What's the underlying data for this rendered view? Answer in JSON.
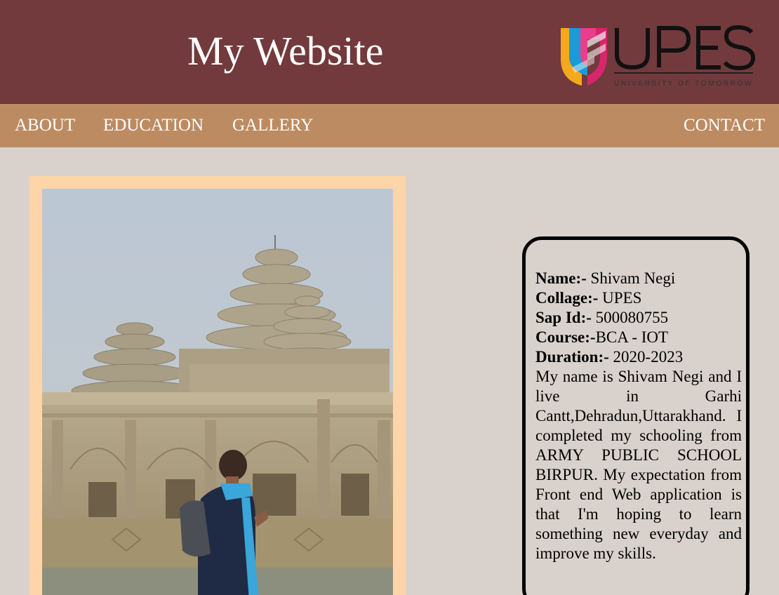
{
  "header": {
    "title": "My Website",
    "logo": {
      "wordmark": "UPES",
      "tagline": "UNIVERSITY OF TOMORROW"
    }
  },
  "nav": {
    "about": "ABOUT",
    "education": "EDUCATION",
    "gallery": "GALLERY",
    "contact": "CONTACT"
  },
  "photo": {
    "icon": "temple-photo"
  },
  "profile": {
    "name_label": "Name:-",
    "name_value": " Shivam Negi",
    "college_label": "Collage:-",
    "college_value": " UPES",
    "sap_label": "Sap Id:-",
    "sap_value": " 500080755",
    "course_label": "Course:-",
    "course_value": "BCA - IOT",
    "duration_label": "Duration:-",
    "duration_value": " 2020-2023",
    "bio": "My name is Shivam Negi and I live in Garhi Cantt,Dehradun,Uttarakhand. I completed my schooling from ARMY PUBLIC SCHOOL BIRPUR. My expectation from Front end Web application is that I'm hoping to learn something new everyday and improve my skills."
  },
  "colors": {
    "header_bg": "#723a3c",
    "nav_bg": "#bd8b62",
    "page_bg": "#d9d2cc",
    "frame_bg": "#fdd5a8"
  }
}
